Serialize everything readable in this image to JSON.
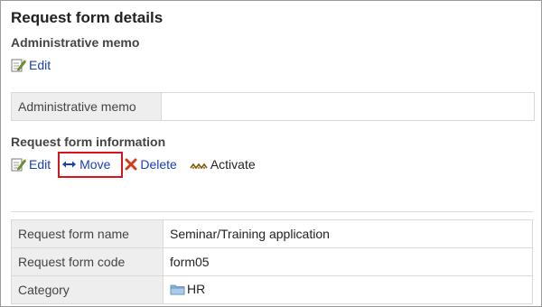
{
  "page": {
    "title": "Request form details"
  },
  "admin_memo_section": {
    "title": "Administrative memo",
    "edit_label": "Edit",
    "edit_icon": "edit-icon",
    "row_label": "Administrative memo",
    "row_value": ""
  },
  "form_info_section": {
    "title": "Request form information",
    "actions": {
      "edit_label": "Edit",
      "edit_icon": "edit-icon",
      "move_label": "Move",
      "move_icon": "move-arrows-icon",
      "delete_label": "Delete",
      "delete_icon": "delete-x-icon",
      "activate_label": "Activate",
      "activate_icon": "activate-icon"
    },
    "highlight_color": "#d8141f",
    "rows": [
      {
        "label": "Request form name",
        "value": "Seminar/Training application"
      },
      {
        "label": "Request form code",
        "value": "form05"
      },
      {
        "label": "Category",
        "value": "HR",
        "icon": "folder-icon"
      }
    ]
  },
  "colors": {
    "link": "#1a3fb5",
    "label_bg": "#eeeeee",
    "border": "#d9d9d9"
  }
}
